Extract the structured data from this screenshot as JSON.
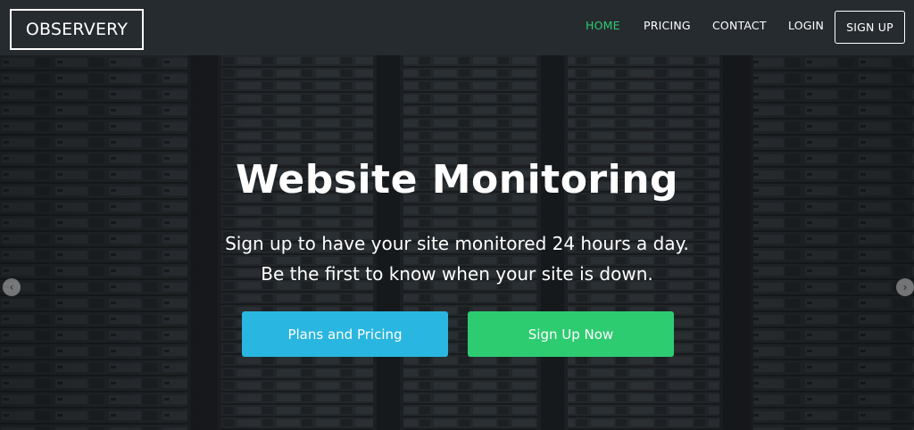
{
  "navbar": {
    "logo": "OBSERVERY",
    "links": {
      "home": "HOME",
      "pricing": "PRICING",
      "contact": "CONTACT",
      "login": "LOGIN"
    },
    "signup": "SIGN UP",
    "active_color": "#2ecc71"
  },
  "hero": {
    "title": "Website Monitoring",
    "line1": "Sign up to have your site monitored 24 hours a day.",
    "line2": "Be the first to know when your site is down.",
    "buttons": {
      "plans": "Plans and Pricing",
      "signup": "Sign Up Now"
    },
    "background_image": "server-rack-photo",
    "colors": {
      "plans_button": "#29b6e0",
      "signup_button": "#2ecc71"
    },
    "carousel": {
      "prev_icon": "chevron-left-icon",
      "next_icon": "chevron-right-icon"
    }
  }
}
